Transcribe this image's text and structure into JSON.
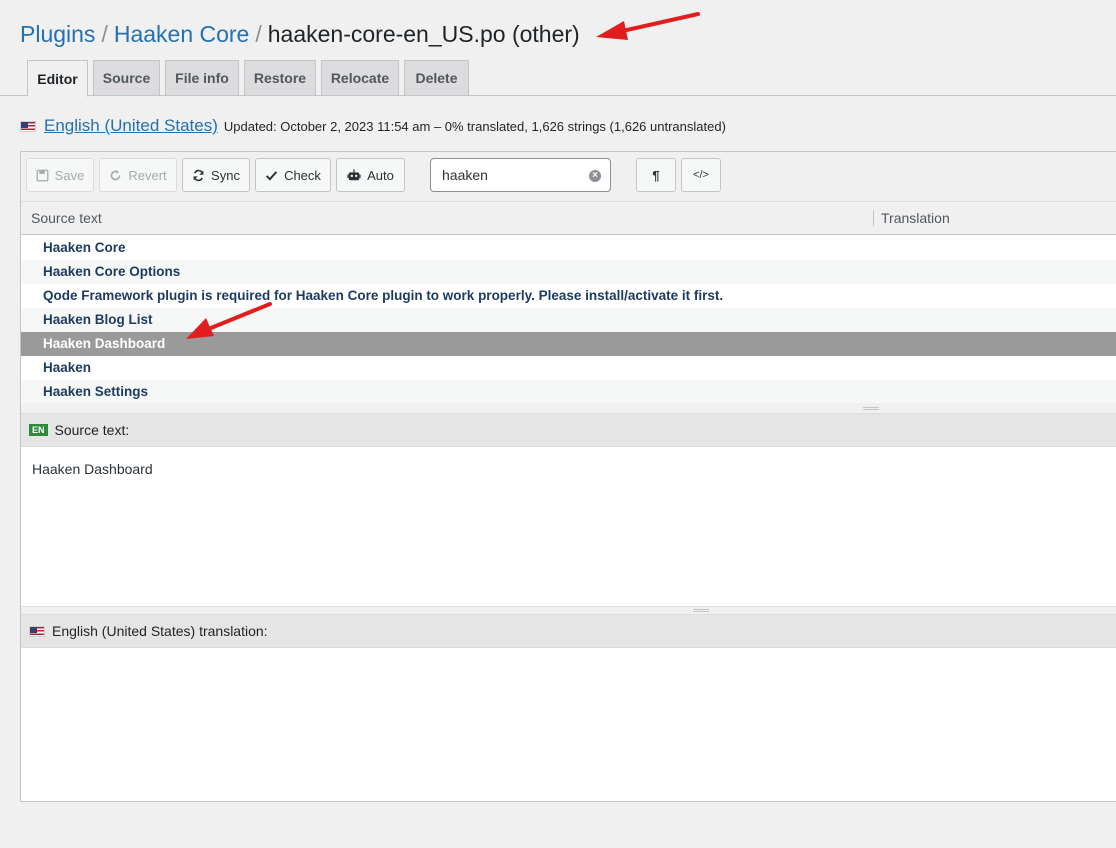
{
  "breadcrumb": {
    "plugins": "Plugins",
    "separator": "/",
    "plugin": "Haaken Core",
    "file": "haaken-core-en_US.po (other)"
  },
  "tabs": [
    {
      "label": "Editor",
      "active": true
    },
    {
      "label": "Source"
    },
    {
      "label": "File info"
    },
    {
      "label": "Restore"
    },
    {
      "label": "Relocate"
    },
    {
      "label": "Delete"
    }
  ],
  "locale": {
    "flag_icon": "us-flag-icon",
    "name": "English (United States)",
    "meta": "Updated: October 2, 2023 11:54 am – 0% translated, 1,626 strings (1,626 untranslated)"
  },
  "toolbar": {
    "save": "Save",
    "revert": "Revert",
    "sync": "Sync",
    "check": "Check",
    "auto": "Auto",
    "search_value": "haaken",
    "pilcrow": "¶",
    "code": "</>"
  },
  "table": {
    "col_source": "Source text",
    "col_translation": "Translation",
    "rows": [
      "Haaken Core",
      "Haaken Core Options",
      "Qode Framework plugin is required for Haaken Core plugin to work properly. Please install/activate it first.",
      "Haaken Blog List",
      "Haaken Dashboard",
      "Haaken",
      "Haaken Settings"
    ],
    "selected_index": 4
  },
  "source_pane": {
    "badge": "EN",
    "title": "Source text:",
    "text": "Haaken Dashboard"
  },
  "translation_pane": {
    "title": "English (United States) translation:",
    "value": ""
  },
  "colors": {
    "link": "#2271b1",
    "selected_row": "#9a9a9a",
    "annotation_arrow": "#e11d1d"
  }
}
